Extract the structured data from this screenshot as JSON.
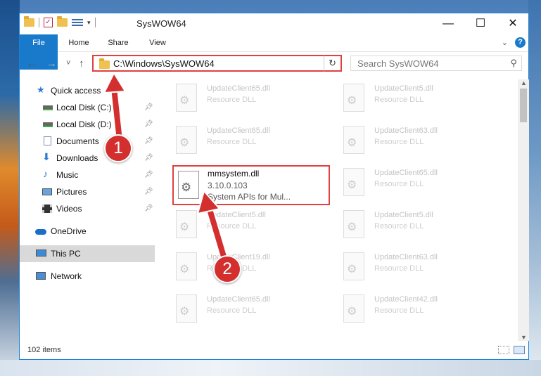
{
  "window": {
    "title": "SysWOW64",
    "controls": {
      "minimize": "—",
      "maximize": "☐",
      "close": "✕"
    }
  },
  "ribbon": {
    "tabs": [
      "File",
      "Home",
      "Share",
      "View"
    ],
    "help": "?"
  },
  "nav": {
    "back": "←",
    "forward": "→",
    "recent": "˅",
    "up": "↑",
    "address": "C:\\Windows\\SysWOW64",
    "refresh": "↻",
    "search_placeholder": "Search SysWOW64"
  },
  "sidebar": {
    "items": [
      {
        "label": "Quick access",
        "icon": "star-icon"
      },
      {
        "label": "Local Disk (C:)",
        "icon": "drive-icon",
        "pinned": true
      },
      {
        "label": "Local Disk (D:)",
        "icon": "drive-icon",
        "pinned": true
      },
      {
        "label": "Documents",
        "icon": "documents-icon",
        "pinned": true
      },
      {
        "label": "Downloads",
        "icon": "download-icon",
        "pinned": true
      },
      {
        "label": "Music",
        "icon": "music-icon",
        "pinned": true
      },
      {
        "label": "Pictures",
        "icon": "pictures-icon",
        "pinned": true
      },
      {
        "label": "Videos",
        "icon": "videos-icon",
        "pinned": true
      },
      {
        "label": "OneDrive",
        "icon": "cloud-icon"
      },
      {
        "label": "This PC",
        "icon": "computer-icon",
        "selected": true
      },
      {
        "label": "Network",
        "icon": "network-icon"
      }
    ]
  },
  "files": [
    {
      "name": "UpdateClient65.dll",
      "desc": "Resource DLL"
    },
    {
      "name": "UpdateClient5.dll",
      "desc": "Resource DLL"
    },
    {
      "name": "UpdateClient65.dll",
      "desc": "Resource DLL"
    },
    {
      "name": "UpdateClient63.dll",
      "desc": "Resource DLL"
    },
    {
      "name": "UpdateClient65.dll",
      "desc": "Resource DLL"
    },
    {
      "name": "UpdateClient5.dll",
      "desc": "Resource DLL"
    },
    {
      "name": "UpdateClient5.dll",
      "desc": "Resource DLL"
    },
    {
      "name": "UpdateClient19.dll",
      "desc": "Resource DLL"
    },
    {
      "name": "UpdateClient63.dll",
      "desc": "Resource DLL"
    },
    {
      "name": "UpdateClient65.dll",
      "desc": "Resource DLL"
    },
    {
      "name": "UpdateClient42.dll",
      "desc": "Resource DLL"
    }
  ],
  "selected_file": {
    "name": "mmsystem.dll",
    "version": "3.10.0.103",
    "desc": "System APIs for Mul..."
  },
  "status": {
    "items": "102 items"
  },
  "annotations": {
    "step1": "1",
    "step2": "2",
    "color": "#d32f2f"
  }
}
